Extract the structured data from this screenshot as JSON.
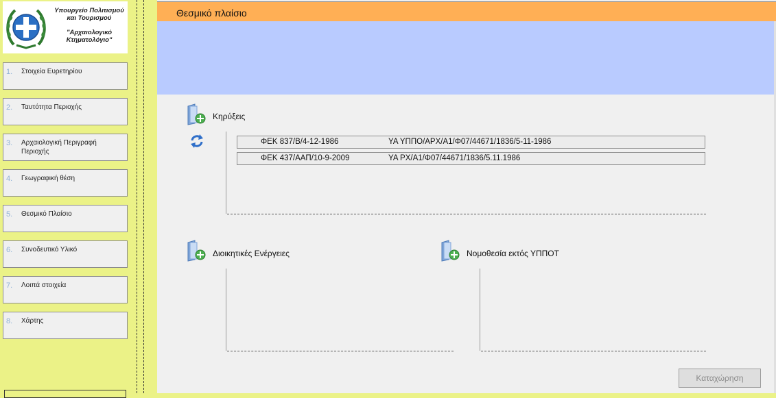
{
  "logo": {
    "ministry_line1": "Υπουργείο Πολιτισμού",
    "ministry_line2": "και Τουρισμού",
    "project_line1": "\"Αρχαιολογικό",
    "project_line2": "Κτηματολόγιο\""
  },
  "sidebar": {
    "items": [
      {
        "num": "1.",
        "label": "Στοιχεία Ευρετηρίου"
      },
      {
        "num": "2.",
        "label": "Ταυτότητα Περιοχής"
      },
      {
        "num": "3.",
        "label": "Αρχαιολογική Περιγραφή Περιοχής"
      },
      {
        "num": "4.",
        "label": "Γεωγραφική θέση"
      },
      {
        "num": "5.",
        "label": "Θεσμικό Πλαίσιο"
      },
      {
        "num": "6.",
        "label": "Συνοδευτικό Υλικό"
      },
      {
        "num": "7.",
        "label": "Λοιπά στοιχεία"
      },
      {
        "num": "8.",
        "label": "Χάρτης"
      }
    ]
  },
  "header": {
    "title": "Θεσμικό πλαίσιο"
  },
  "sections": {
    "declarations": {
      "title": "Κηρύξεις",
      "entries": [
        {
          "fek": "ΦΕΚ 837/Β/4-12-1986",
          "decision": "ΥΑ ΥΠΠΟ/ΑΡΧ/Α1/Φ07/44671/1836/5-11-1986"
        },
        {
          "fek": "ΦΕΚ 437/ΑΑΠ/10-9-2009",
          "decision": "ΥΑ ΡΧ/Α1/Φ07/44671/1836/5.11.1986"
        }
      ]
    },
    "admin_actions": {
      "title": "Διοικητικές Ενέργειες"
    },
    "legislation": {
      "title": "Νομοθεσία εκτός ΥΠΠΟΤ"
    }
  },
  "actions": {
    "save_label": "Καταχώρηση"
  },
  "colors": {
    "sidebar_bg": "#ebf287",
    "header_bg": "#ffaf55",
    "band_bg": "#b9cbff",
    "content_bg": "#f0f0f0"
  },
  "icons": {
    "section_add": "folder-add-icon",
    "refresh": "refresh-icon"
  }
}
